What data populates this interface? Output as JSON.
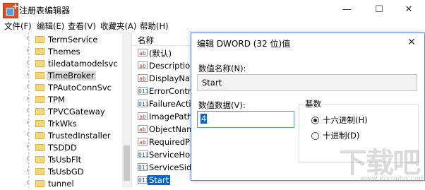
{
  "window": {
    "title": "注册表编辑器",
    "controls": {
      "minimize": "—",
      "maximize": "☐",
      "close": "✕"
    }
  },
  "menu": [
    {
      "label": "文件(F)"
    },
    {
      "label": "编辑(E)"
    },
    {
      "label": "查看(V)"
    },
    {
      "label": "收藏夹(A)"
    },
    {
      "label": "帮助(H)"
    }
  ],
  "tree": {
    "items": [
      {
        "label": "TermService",
        "selected": false
      },
      {
        "label": "Themes",
        "selected": false
      },
      {
        "label": "tiledatamodelsvc",
        "selected": false
      },
      {
        "label": "TimeBroker",
        "selected": true
      },
      {
        "label": "TPAutoConnSvc",
        "selected": false
      },
      {
        "label": "TPM",
        "selected": false
      },
      {
        "label": "TPVCGateway",
        "selected": false
      },
      {
        "label": "TrkWks",
        "selected": false
      },
      {
        "label": "TrustedInstaller",
        "selected": false
      },
      {
        "label": "TSDDD",
        "selected": false
      },
      {
        "label": "TsUsbFlt",
        "selected": false
      },
      {
        "label": "TsUsbGD",
        "selected": false
      },
      {
        "label": "tunnel",
        "selected": false
      }
    ]
  },
  "list": {
    "header": "名称",
    "rows": [
      {
        "icon": "ab",
        "name": "(默认)",
        "selected": false
      },
      {
        "icon": "ab",
        "name": "Description",
        "selected": false
      },
      {
        "icon": "ab",
        "name": "DisplayNam",
        "selected": false
      },
      {
        "icon": "bin",
        "name": "ErrorContro",
        "selected": false
      },
      {
        "icon": "bin",
        "name": "FailureActio",
        "selected": false
      },
      {
        "icon": "ab",
        "name": "ImagePath",
        "selected": false
      },
      {
        "icon": "ab",
        "name": "ObjectName",
        "selected": false
      },
      {
        "icon": "ab",
        "name": "RequiredPriv",
        "selected": false
      },
      {
        "icon": "bin",
        "name": "ServiceHostS",
        "selected": false
      },
      {
        "icon": "bin",
        "name": "ServiceSidTy",
        "selected": false
      },
      {
        "icon": "bin",
        "name": "Start",
        "selected": true
      }
    ]
  },
  "dialog": {
    "title": "编辑 DWORD (32 位)值",
    "close": "✕",
    "name_label": "数值名称(N):",
    "name_value": "Start",
    "data_label": "数值数据(V):",
    "data_value": "4",
    "base_label": "基数",
    "radios": [
      {
        "label": "十六进制(H)",
        "checked": true
      },
      {
        "label": "十进制(D)",
        "checked": false
      }
    ]
  },
  "watermark": {
    "text": "下载吧",
    "url": "www.xiazaiba.com"
  }
}
